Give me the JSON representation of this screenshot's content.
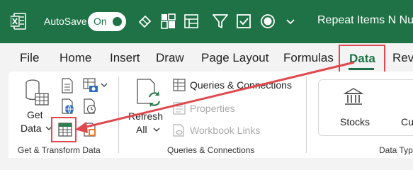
{
  "titlebar": {
    "app_icon": "excel-icon",
    "autosave_label": "AutoSave",
    "toggle_state": "On",
    "document_title": "Repeat Items N Num",
    "qat_icons": [
      "eraser-icon",
      "pivot-grid-icon",
      "filter-icon",
      "checkbox-icon",
      "circle-record-icon"
    ]
  },
  "tabs": [
    "File",
    "Home",
    "Insert",
    "Draw",
    "Page Layout",
    "Formulas",
    "Data",
    "Revi"
  ],
  "active_tab": "Data",
  "ribbon": {
    "get_data": {
      "line1": "Get",
      "line2": "Data"
    },
    "get_transform_label": "Get & Transform Data",
    "refresh": {
      "line1": "Refresh",
      "line2": "All"
    },
    "queries_connections": "Queries & Connections",
    "properties": "Properties",
    "workbook_links": "Workbook Links",
    "queries_group_label": "Queries & Connections",
    "stocks": "Stocks",
    "currencies_partial": "Cu",
    "data_types_label": "Data Type"
  },
  "colors": {
    "title_green": "#1f7246",
    "highlight_red": "#e0484f"
  }
}
